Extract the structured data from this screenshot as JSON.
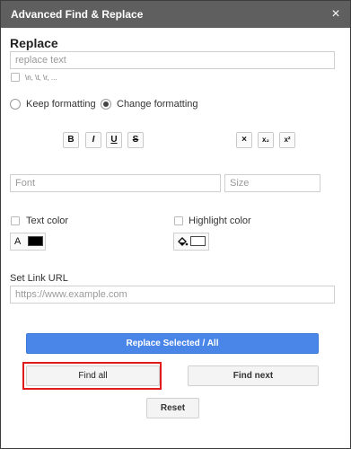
{
  "dialog": {
    "title": "Advanced Find & Replace",
    "close_glyph": "×"
  },
  "replace": {
    "heading": "Replace",
    "input_placeholder": "replace text",
    "escape_label": "\\n, \\t, \\r, ..."
  },
  "formatting": {
    "keep_label": "Keep formatting",
    "change_label": "Change formatting",
    "selected": "change",
    "buttons": [
      "B",
      "I",
      "U",
      "S"
    ],
    "buttons_right": [
      "×",
      "x₂",
      "x²"
    ]
  },
  "font": {
    "font_placeholder": "Font",
    "size_placeholder": "Size"
  },
  "colors": {
    "text_color_label": "Text color",
    "text_swatch_letter": "A",
    "text_swatch_color": "#000000",
    "highlight_label": "Highlight color",
    "highlight_swatch_color": "#ffffff"
  },
  "link": {
    "label": "Set Link URL",
    "placeholder": "https://www.example.com"
  },
  "actions": {
    "replace_selected": "Replace Selected / All",
    "find_all": "Find all",
    "find_next": "Find next",
    "reset": "Reset"
  }
}
